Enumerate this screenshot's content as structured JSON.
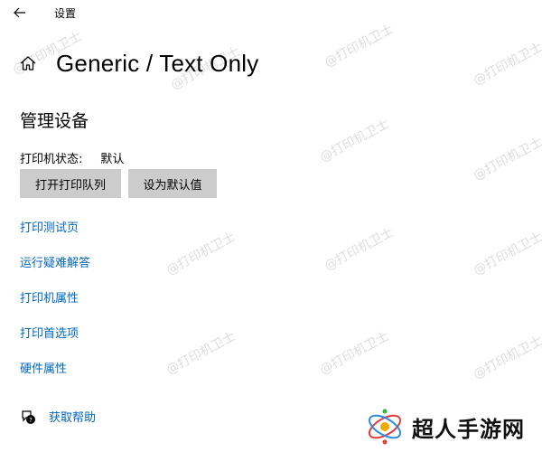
{
  "window": {
    "title": "设置"
  },
  "header": {
    "page_title": "Generic / Text Only"
  },
  "section": {
    "title": "管理设备"
  },
  "status": {
    "label": "打印机状态:",
    "value": "默认"
  },
  "buttons": {
    "open_queue": "打开打印队列",
    "set_default": "设为默认值"
  },
  "links": [
    "打印测试页",
    "运行疑难解答",
    "打印机属性",
    "打印首选项",
    "硬件属性"
  ],
  "help": {
    "label": "获取帮助"
  },
  "watermark": {
    "text": "@打印机卫士"
  },
  "brand": {
    "text": "超人手游网"
  },
  "colors": {
    "link": "#0067c0",
    "button_bg": "#cccccc"
  },
  "icons": {
    "back": "back-arrow-icon",
    "home": "home-icon",
    "help": "chat-help-icon"
  }
}
